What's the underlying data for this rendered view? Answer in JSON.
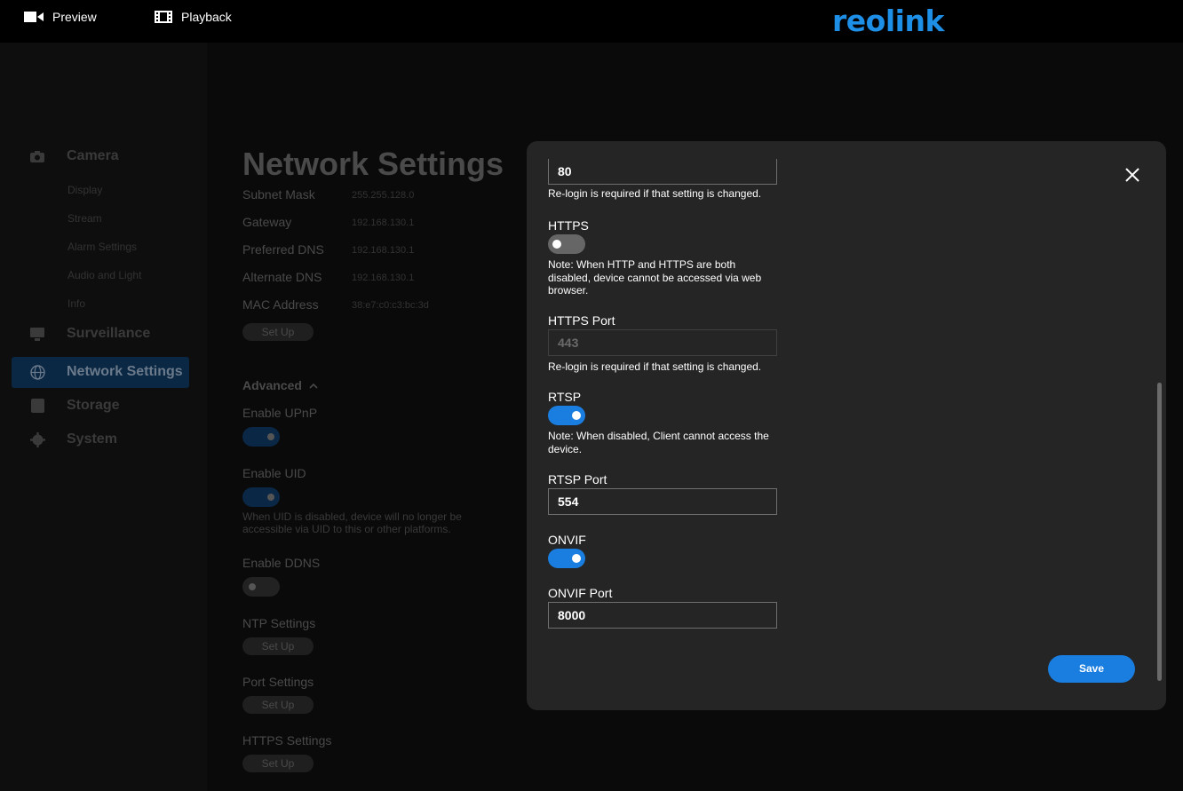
{
  "topbar": {
    "preview_label": "Preview",
    "playback_label": "Playback",
    "logo_text": "reolink",
    "brand_color": "#1e8fe6"
  },
  "sidebar": {
    "camera": "Camera",
    "camera_items": [
      "Display",
      "Stream",
      "Alarm Settings",
      "Audio and Light",
      "Info"
    ],
    "surveillance": "Surveillance",
    "network": "Network Settings",
    "storage": "Storage",
    "system": "System"
  },
  "page": {
    "title": "Network Settings",
    "rows": [
      {
        "label": "Subnet Mask",
        "value": "255.255.128.0"
      },
      {
        "label": "Gateway",
        "value": "192.168.130.1"
      },
      {
        "label": "Preferred DNS",
        "value": "192.168.130.1"
      },
      {
        "label": "Alternate DNS",
        "value": "192.168.130.1"
      },
      {
        "label": "MAC Address",
        "value": "38:e7:c0:c3:bc:3d"
      }
    ],
    "setup_label": "Set Up",
    "advanced": "Advanced",
    "upnp": "Enable UPnP",
    "uid": "Enable UID",
    "uid_note": "When UID is disabled, device will no longer be accessible via UID to this or other platforms.",
    "ddns": "Enable DDNS",
    "ntp": "NTP Settings",
    "port": "Port Settings",
    "https_settings": "HTTPS Settings"
  },
  "modal": {
    "http_port_value": "80",
    "relogin_note": "Re-login is required if that setting is changed.",
    "https_label": "HTTPS",
    "https_enabled": false,
    "https_note": "Note: When HTTP and HTTPS are both disabled, device cannot be accessed via web browser.",
    "https_port_label": "HTTPS Port",
    "https_port_value": "443",
    "rtsp_label": "RTSP",
    "rtsp_enabled": true,
    "rtsp_note": "Note: When disabled, Client cannot access the device.",
    "rtsp_port_label": "RTSP Port",
    "rtsp_port_value": "554",
    "onvif_label": "ONVIF",
    "onvif_enabled": true,
    "onvif_port_label": "ONVIF Port",
    "onvif_port_value": "8000",
    "save_label": "Save",
    "accent_color": "#1a7de0"
  }
}
